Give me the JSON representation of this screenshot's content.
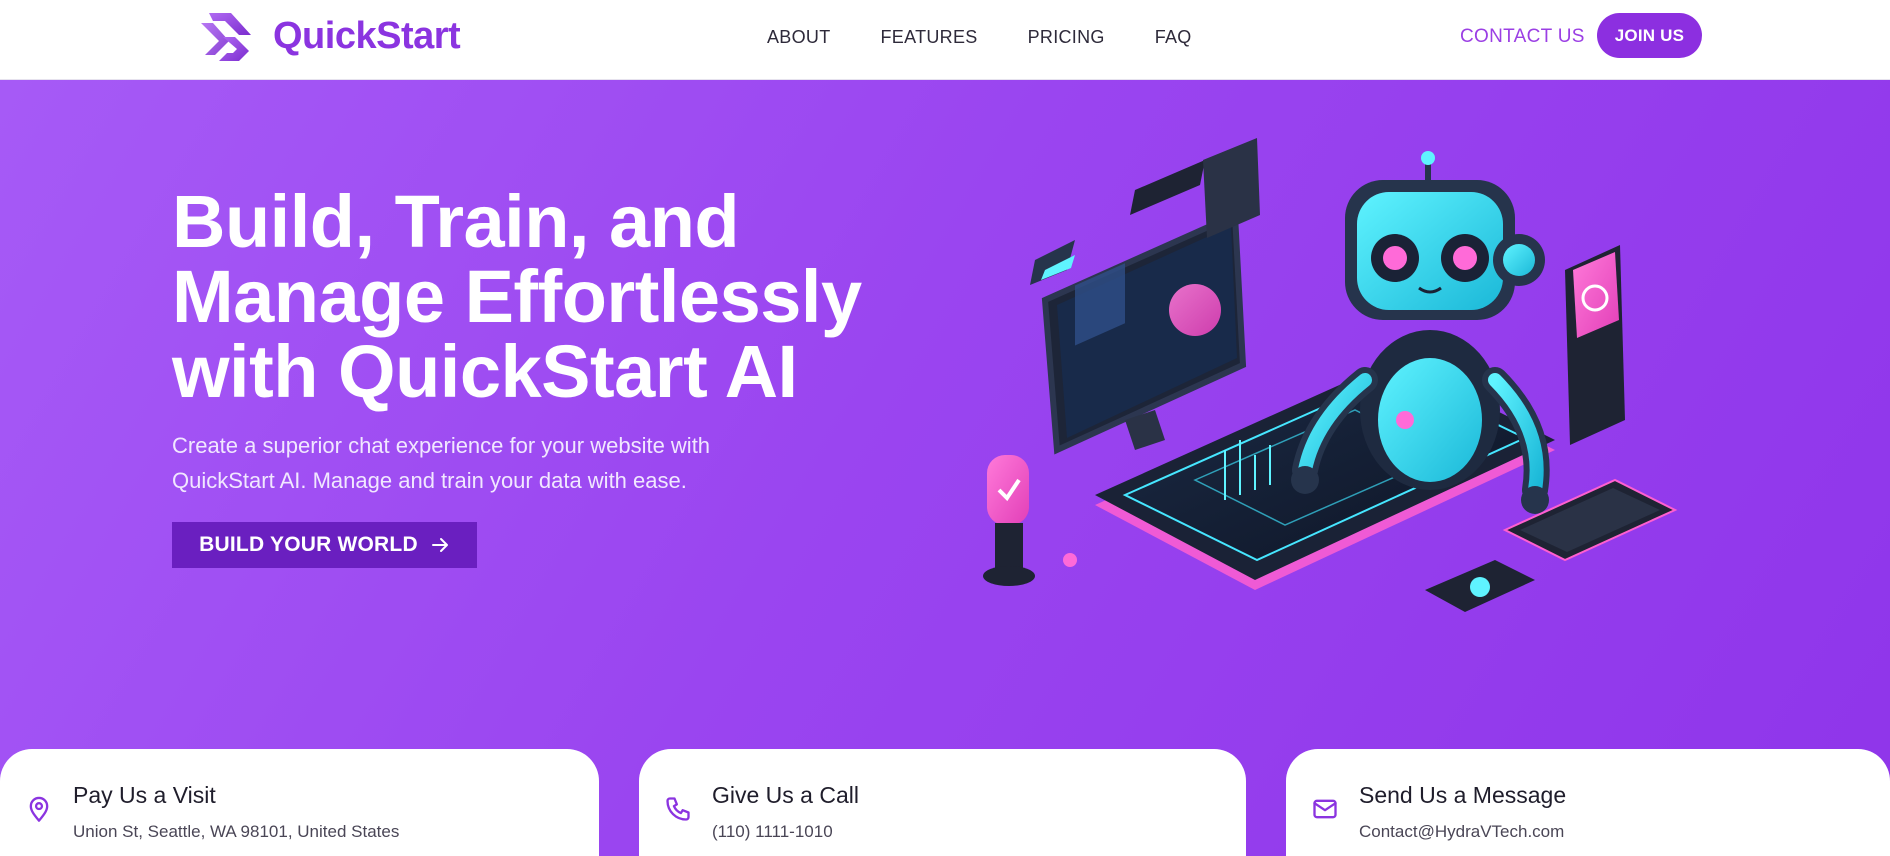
{
  "header": {
    "brand": "QuickStart",
    "nav": [
      "ABOUT",
      "FEATURES",
      "PRICING",
      "FAQ"
    ],
    "contact_label": "CONTACT US",
    "join_label": "JOIN US"
  },
  "hero": {
    "title_lines": [
      "Build, Train, and",
      "Manage Effortlessly",
      "with QuickStart AI"
    ],
    "subtitle_lines": [
      "Create a superior chat experience for your website with",
      "QuickStart AI. Manage and train your data with ease."
    ],
    "cta_label": "BUILD YOUR WORLD",
    "illustration": "robot-at-computer-illustration"
  },
  "contact_cards": [
    {
      "icon": "location-pin-icon",
      "title": "Pay Us a Visit",
      "line": "Union St, Seattle, WA 98101, United States"
    },
    {
      "icon": "phone-icon",
      "title": "Give Us a Call",
      "line": "(110) 1111-1010"
    },
    {
      "icon": "mail-icon",
      "title": "Send Us a Message",
      "line": "Contact@HydraVTech.com"
    }
  ],
  "colors": {
    "brand": "#8b34e0",
    "hero_gradient_start": "#a65af6",
    "hero_gradient_end": "#8f35ea",
    "cta_bg": "#6a1fc0"
  }
}
